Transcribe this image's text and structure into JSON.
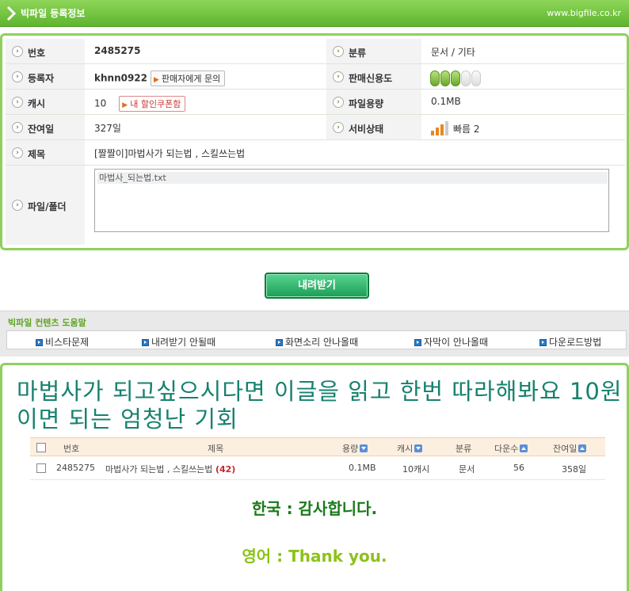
{
  "header": {
    "title": "빅파일 등록정보",
    "url": "www.bigfile.co.kr"
  },
  "info": {
    "num_label": "번호",
    "num_value": "2485275",
    "category_label": "분류",
    "category_value": "문서 / 기타",
    "uploader_label": "등록자",
    "uploader_value": "khnn0922",
    "contact_button": "판매자에게 문의",
    "credit_label": "판매신용도",
    "credit_level": 3,
    "credit_max": 5,
    "cash_label": "캐시",
    "cash_value": "10",
    "coupon_button": "내 할인쿠폰함",
    "size_label": "파일용량",
    "size_value": "0.1MB",
    "days_label": "잔여일",
    "days_value": "327일",
    "status_label": "서비상태",
    "status_value": "빠름 2",
    "title_label": "제목",
    "title_value": "[짤짤이]마법사가 되는법 , 스킬쓰는법",
    "files_label": "파일/폴더",
    "file_name": "마법사_되는법.txt"
  },
  "download_button": "내려받기",
  "help": {
    "title": "빅파일 컨텐츠 도움말",
    "links": [
      "비스타문제",
      "내려받기 안될때",
      "화면소리 안나올때",
      "자막이 안나올때",
      "다운로드방법"
    ]
  },
  "content": {
    "headline": "마법사가 되고싶으시다면 이글을 읽고 한번 따라해봐요 10원이면 되는 엄청난 기회",
    "columns": [
      "번호",
      "제목",
      "용량",
      "캐시",
      "분류",
      "다운수",
      "잔여일"
    ],
    "row": {
      "num": "2485275",
      "title": "마법사가 되는법 , 스킬쓰는법",
      "count": "(42)",
      "size": "0.1MB",
      "cash": "10캐시",
      "category": "문서",
      "downloads": "56",
      "days": "358일"
    },
    "thanks_ko": "한국 : 감사합니다.",
    "thanks_en": "영어 : Thank you."
  }
}
